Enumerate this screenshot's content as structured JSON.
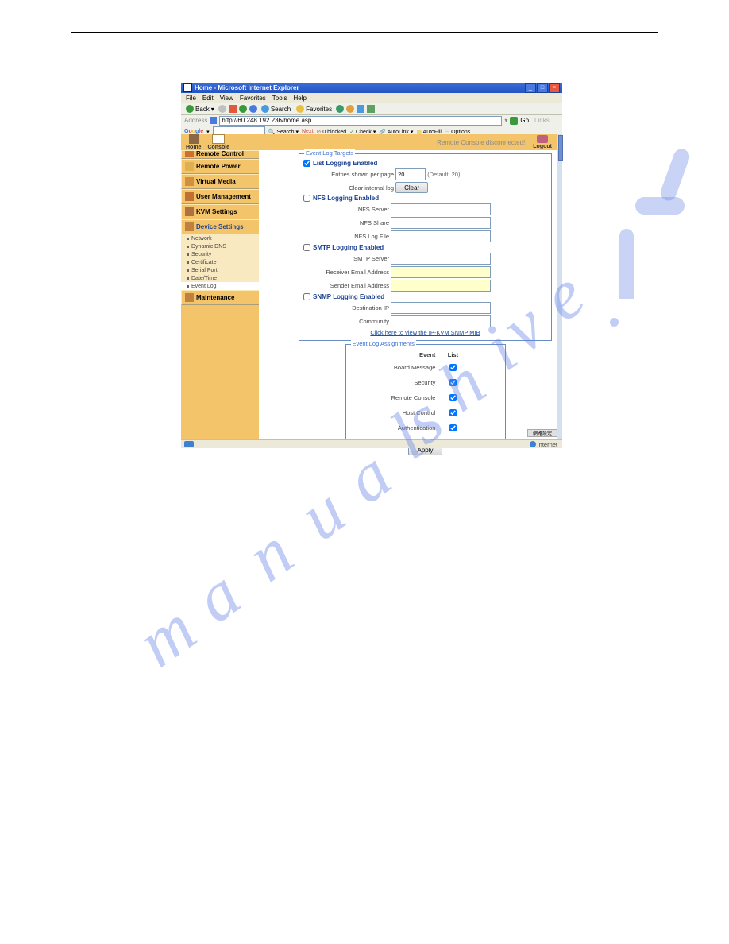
{
  "window": {
    "title": "Home - Microsoft Internet Explorer",
    "btn_min": "_",
    "btn_max": "□",
    "btn_close": "×"
  },
  "menubar": {
    "file": "File",
    "edit": "Edit",
    "view": "View",
    "favorites": "Favorites",
    "tools": "Tools",
    "help": "Help"
  },
  "toolbar": {
    "back": "Back",
    "search": "Search",
    "favorites_btn": "Favorites"
  },
  "addrbar": {
    "label": "Address",
    "url": "http://60.248.192.236/home.asp",
    "go": "Go",
    "links": "Links"
  },
  "googlebar": {
    "label": "Google",
    "search": "Search",
    "next": "Next",
    "blocked": "0 blocked",
    "check": "Check",
    "autolink": "AutoLink",
    "autofill": "AutoFill",
    "options": "Options"
  },
  "header": {
    "home": "Home",
    "console": "Console",
    "status": "Remote Console disconnected!",
    "logout": "Logout"
  },
  "sidebar": {
    "remote_control": "Remote Control",
    "remote_power": "Remote Power",
    "virtual_media": "Virtual Media",
    "user_mgmt": "User Management",
    "kvm": "KVM Settings",
    "device": "Device Settings",
    "subs": {
      "network": "Network",
      "ddns": "Dynamic DNS",
      "security": "Security",
      "cert": "Certificate",
      "serial": "Serial Port",
      "datetime": "Date/Time",
      "eventlog": "Event Log"
    },
    "maintenance": "Maintenance"
  },
  "targets": {
    "legend": "Event Log Targets",
    "list_logging": "List Logging Enabled",
    "entries_label": "Entries shown per page",
    "entries_value": "20",
    "entries_default": "(Default: 20)",
    "clear_label": "Clear internal log",
    "clear_btn": "Clear",
    "nfs_logging": "NFS Logging Enabled",
    "nfs_server": "NFS Server",
    "nfs_share": "NFS Share",
    "nfs_file": "NFS Log File",
    "smtp_logging": "SMTP Logging Enabled",
    "smtp_server": "SMTP Server",
    "recv_email": "Receiver Email Address",
    "send_email": "Sender Email Address",
    "snmp_logging": "SNMP Logging Enabled",
    "dest_ip": "Destination IP",
    "community": "Community",
    "mib_link": "Click here to view the IP-KVM SNMP MIB"
  },
  "assignments": {
    "legend": "Event Log Assignments",
    "hdr_event": "Event",
    "hdr_list": "List",
    "rows": {
      "r0": "Board Message",
      "r1": "Security",
      "r2": "Remote Console",
      "r3": "Host Control",
      "r4": "Authentication"
    }
  },
  "apply": "Apply",
  "statusbar": {
    "internet": "Internet"
  },
  "mediabox": "網路設定"
}
